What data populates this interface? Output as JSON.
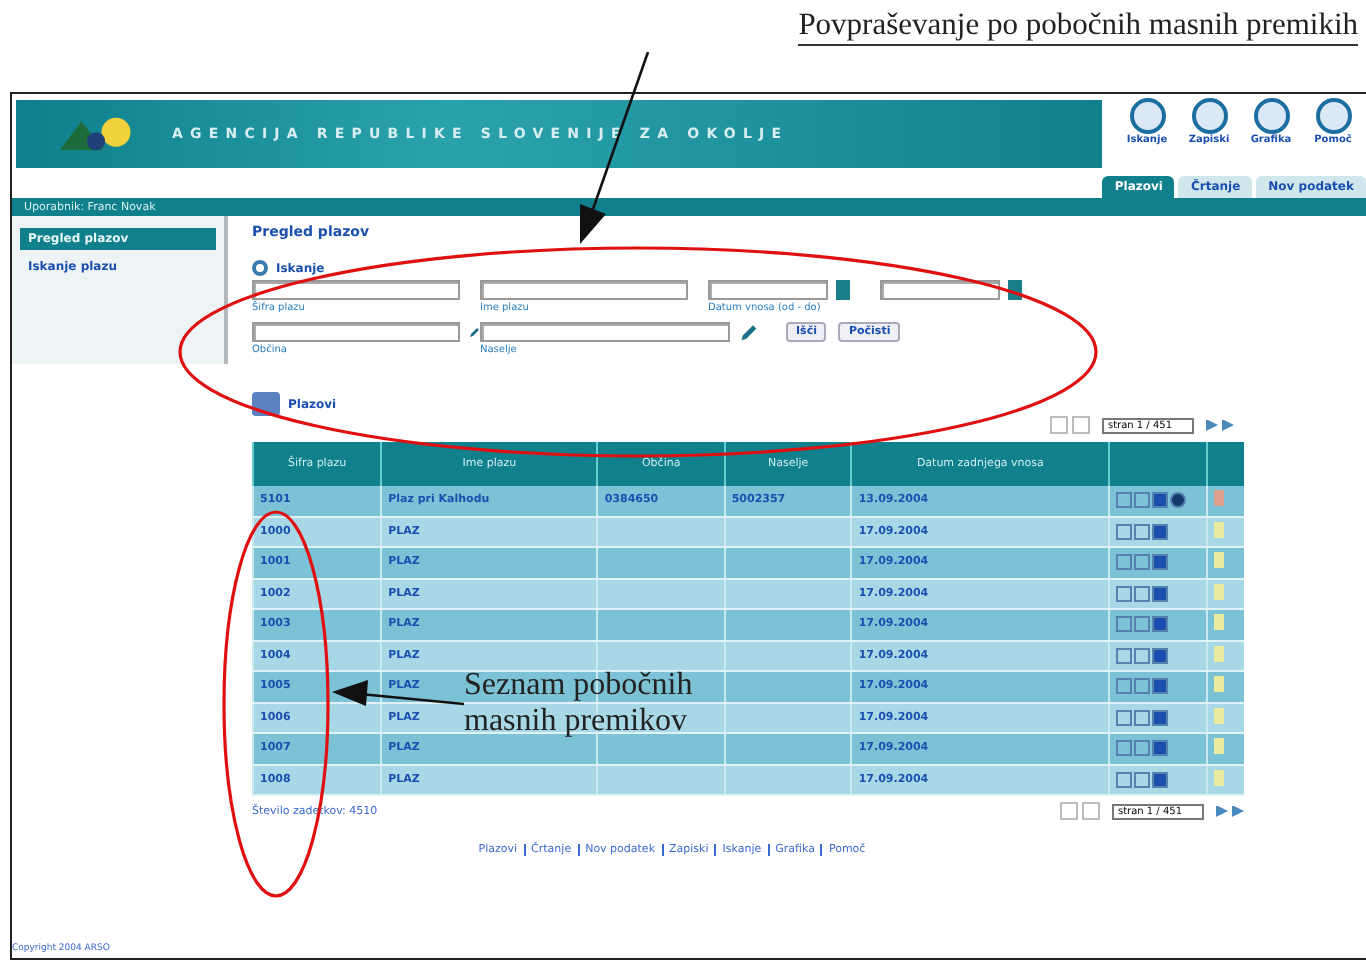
{
  "annotations": [
    {
      "kind": "top",
      "text": "Povpraševanje po pobočnih masnih premikih"
    },
    {
      "kind": "side",
      "text": "Seznam pobočnih masnih premikov"
    }
  ],
  "header": {
    "title": "AGENCIJA REPUBLIKE SLOVENIJE ZA OKOLJE",
    "tools": [
      "Iskanje",
      "Zapiski",
      "Grafika",
      "Pomoč"
    ]
  },
  "tabs": [
    {
      "label": "Plazovi",
      "selected": true
    },
    {
      "label": "Črtanje",
      "selected": false
    },
    {
      "label": "Nov podatek",
      "selected": false
    }
  ],
  "user_bar": "Uporabnik: Franc Novak",
  "sidebar": {
    "items": [
      {
        "label": "Pregled plazov",
        "selected": true
      },
      {
        "label": "Iskanje plazu",
        "selected": false
      }
    ]
  },
  "page_title": "Pregled plazov",
  "search": {
    "title": "Iskanje",
    "fields": [
      {
        "kind": "text",
        "caption": "Šifra plazu"
      },
      {
        "kind": "text",
        "caption": "Ime plazu"
      },
      {
        "kind": "date",
        "caption": "Datum vnosa (od - do)"
      },
      {
        "kind": "date"
      },
      {
        "kind": "pick",
        "caption": "Občina"
      },
      {
        "kind": "pick",
        "caption": "Naselje"
      }
    ],
    "buttons": [
      "Išči",
      "Počisti"
    ]
  },
  "list_title": "Plazovi",
  "pager": {
    "top_page": "stran 1 / 451",
    "bottom_page": "stran 1 / 451"
  },
  "table": {
    "columns": [
      "Šifra plazu",
      "Ime plazu",
      "Občina",
      "Naselje",
      "Datum zadnjega vnosa"
    ],
    "rows": [
      {
        "id": "5101",
        "name": "Plaz pri Kalhodu",
        "municipality": "0384650",
        "settlement": "5002357",
        "date": "13.09.2004",
        "map": true,
        "color": "#e0a090"
      },
      {
        "id": "1000",
        "name": "PLAZ",
        "date": "17.09.2004",
        "map": false,
        "color": "#e8ec9c"
      },
      {
        "id": "1001",
        "name": "PLAZ",
        "date": "17.09.2004",
        "map": false,
        "color": "#e8ec9c"
      },
      {
        "id": "1002",
        "name": "PLAZ",
        "date": "17.09.2004",
        "map": false,
        "color": "#e8ec9c"
      },
      {
        "id": "1003",
        "name": "PLAZ",
        "date": "17.09.2004",
        "map": false,
        "color": "#e8ec9c"
      },
      {
        "id": "1004",
        "name": "PLAZ",
        "date": "17.09.2004",
        "map": false,
        "color": "#e8ec9c"
      },
      {
        "id": "1005",
        "name": "PLAZ",
        "date": "17.09.2004",
        "map": false,
        "color": "#e8ec9c"
      },
      {
        "id": "1006",
        "name": "PLAZ",
        "date": "17.09.2004",
        "map": false,
        "color": "#e8ec9c"
      },
      {
        "id": "1007",
        "name": "PLAZ",
        "date": "17.09.2004",
        "map": false,
        "color": "#e8ec9c"
      },
      {
        "id": "1008",
        "name": "PLAZ",
        "date": "17.09.2004",
        "map": false,
        "color": "#e8ec9c"
      }
    ]
  },
  "total": "Število zadetkov: 4510",
  "footer_links": [
    "Plazovi",
    "Črtanje",
    "Nov podatek",
    "Zapiski",
    "Iskanje",
    "Grafika",
    "Pomoč"
  ],
  "copyright": "Copyright 2004 ARSO"
}
